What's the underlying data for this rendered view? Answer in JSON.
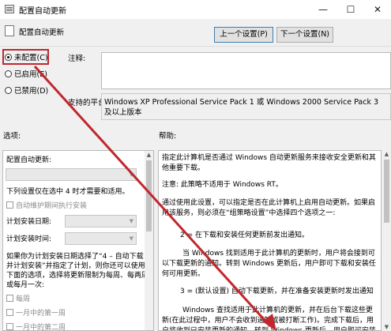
{
  "window": {
    "title": "配置自动更新",
    "minimize_glyph": "—",
    "maximize_glyph": "☐",
    "close_glyph": "✕"
  },
  "header": {
    "title": "配置自动更新",
    "prev_button": "上一个设置(P)",
    "next_button": "下一个设置(N)"
  },
  "state": {
    "options": [
      {
        "label": "未配置(C)",
        "selected": true
      },
      {
        "label": "已启用(E)",
        "selected": false
      },
      {
        "label": "已禁用(D)",
        "selected": false
      }
    ],
    "comment_label": "注释:",
    "platform_label": "支持的平台:",
    "platform_value": "Windows XP Professional Service Pack 1 或 Windows 2000 Service Pack 3 及以上版本"
  },
  "options_pane": {
    "label": "选项:",
    "title": "配置自动更新:",
    "note": "下列设置仅在选中 4 时才需要和适用。",
    "install_during_maintenance": "自动维护期间执行安装",
    "install_day_label": "计划安装日期:",
    "install_time_label": "计划安装时间:",
    "description": [
      "如果你为计划安装日期选择了“4 – 自动下载",
      "并计划安装”并指定了计划，则你还可以使用",
      "下面的选项，选择将更新限制为每周、每两周",
      "或每月一次:"
    ],
    "weekly": "每周",
    "first_week": "一月中的第一周",
    "second_week": "一月中的第二周"
  },
  "help_pane": {
    "label": "帮助:",
    "paragraphs": [
      "指定此计算机是否通过 Windows 自动更新服务来接收安全更新和其他重要下载。",
      "注意: 此策略不适用于 Windows RT。",
      "通过使用此设置，可以指定是否在此计算机上启用自动更新。如果启用该服务，则必须在“组策略设置”中选择四个选项之一:",
      "2 = 在下载和安装任何更新前发出通知。",
      "当 Windows 找到适用于此计算机的更新时，用户将会接到可以下载更新的通知。转到 Windows 更新后，用户即可下载和安装任何可用更新。",
      "3 = (默认设置) 自动下载更新，并在准备安装更新时发出通知",
      "Windows 查找适用于此计算机的更新，并在后台下载这些更新(在此过程中，用户不会收到通知或被打断工作)。完成下载后，用户将收到已安装更新的通知，转到 Windows 更新后，用户即可安装更新。"
    ]
  },
  "colors": {
    "highlight_box": "#c1272d",
    "annotation_arrow": "#c1272d"
  }
}
